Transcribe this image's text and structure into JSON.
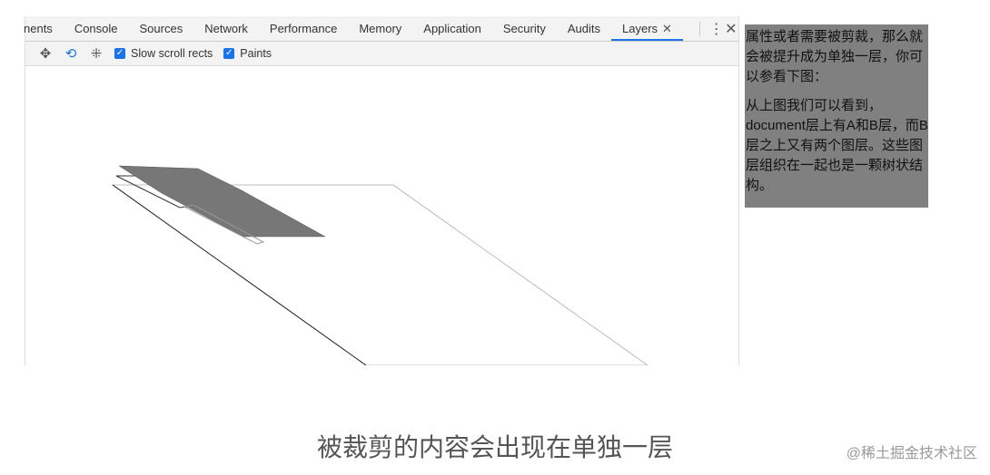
{
  "devtools": {
    "tabs": [
      "nents",
      "Console",
      "Sources",
      "Network",
      "Performance",
      "Memory",
      "Application",
      "Security",
      "Audits",
      "Layers"
    ],
    "active_tab": "Layers",
    "toolbar": {
      "slow_scroll_label": "Slow scroll rects",
      "paints_label": "Paints",
      "slow_scroll_checked": true,
      "paints_checked": true
    },
    "icons": [
      "pan-icon",
      "rotate-icon",
      "reset-transform-icon"
    ]
  },
  "note": {
    "para1": "属性或者需要被剪裁，那么就会被提升成为单独一层，你可以参看下图：",
    "para2": "从上图我们可以看到，document层上有A和B层，而B层之上又有两个图层。这些图层组织在一起也是一颗树状结构。"
  },
  "caption": "被裁剪的内容会出现在单独一层",
  "watermark": "@稀土掘金技术社区"
}
